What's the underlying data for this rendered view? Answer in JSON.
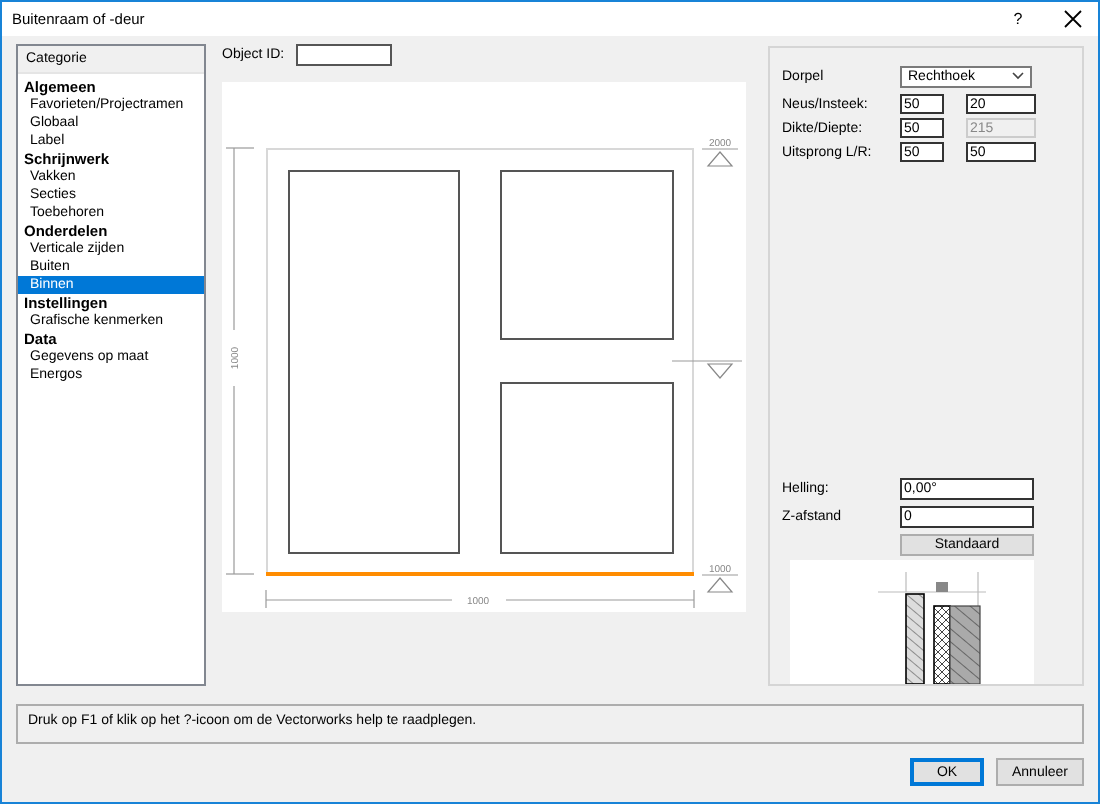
{
  "window": {
    "title": "Buitenraam of -deur",
    "help": "?"
  },
  "categories": {
    "header": "Categorie",
    "groups": [
      {
        "label": "Algemeen",
        "selected": false,
        "children": [
          {
            "label": "Favorieten/Projectramen",
            "selected": false
          },
          {
            "label": "Globaal",
            "selected": false
          },
          {
            "label": "Label",
            "selected": false
          }
        ]
      },
      {
        "label": "Schrijnwerk",
        "selected": false,
        "children": [
          {
            "label": "Vakken",
            "selected": false
          },
          {
            "label": "Secties",
            "selected": false
          },
          {
            "label": "Toebehoren",
            "selected": false
          }
        ]
      },
      {
        "label": "Onderdelen",
        "selected": false,
        "children": [
          {
            "label": "Verticale zijden",
            "selected": false
          },
          {
            "label": "Buiten",
            "selected": false
          },
          {
            "label": "Binnen",
            "selected": true
          }
        ]
      },
      {
        "label": "Instellingen",
        "selected": false,
        "children": [
          {
            "label": "Grafische kenmerken",
            "selected": false
          }
        ]
      },
      {
        "label": "Data",
        "selected": false,
        "children": [
          {
            "label": "Gegevens op maat",
            "selected": false
          },
          {
            "label": "Energos",
            "selected": false
          }
        ]
      }
    ]
  },
  "object_id": {
    "label": "Object ID:"
  },
  "preview": {
    "height_dimension": "1000",
    "width_dimension": "1000",
    "top_level": "2000",
    "bottom_level": "1000"
  },
  "properties": {
    "dorpel": {
      "label": "Dorpel",
      "value": "Rechthoek"
    },
    "rows": [
      {
        "label": "Neus/Insteek:",
        "fields": [
          {
            "value": "50",
            "disabled": false
          },
          {
            "value": "20",
            "disabled": false
          }
        ]
      },
      {
        "label": "Dikte/Diepte:",
        "fields": [
          {
            "value": "50",
            "disabled": false
          },
          {
            "value": "215",
            "disabled": true
          }
        ]
      },
      {
        "label": "Uitsprong L/R:",
        "fields": [
          {
            "value": "50",
            "disabled": false
          },
          {
            "value": "50",
            "disabled": false
          }
        ]
      }
    ],
    "helling": {
      "label": "Helling:",
      "value": "0,00°"
    },
    "z_afstand": {
      "label": "Z-afstand",
      "value": "0"
    },
    "default_button": "Standaard"
  },
  "help_text": "Druk op F1 of klik op het ?-icoon om de Vectorworks help te raadplegen.",
  "buttons": [
    {
      "label": "OK",
      "default": true
    },
    {
      "label": "Annuleer",
      "default": false
    }
  ]
}
